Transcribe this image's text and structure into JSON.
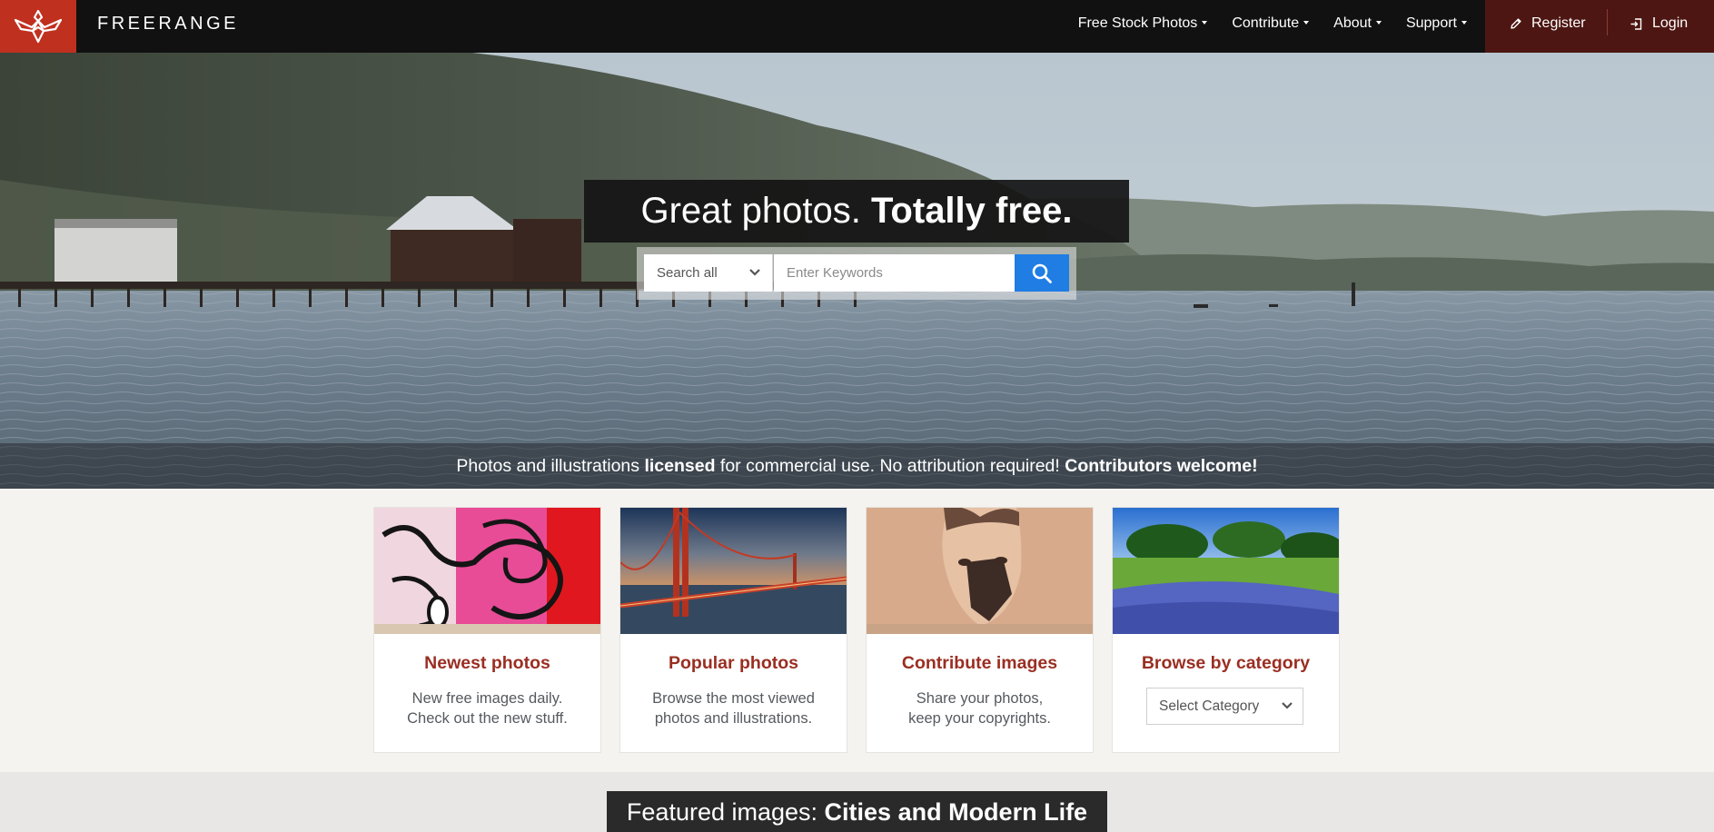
{
  "brand": {
    "name": "FREERANGE",
    "logo_color": "#c0301f",
    "logo_icon": "bird-logo-icon"
  },
  "nav": {
    "items": [
      {
        "label": "Free Stock Photos"
      },
      {
        "label": "Contribute"
      },
      {
        "label": "About"
      },
      {
        "label": "Support"
      }
    ],
    "register_label": "Register",
    "login_label": "Login",
    "register_icon": "pencil-icon",
    "login_icon": "login-icon"
  },
  "hero": {
    "title_light": "Great photos.",
    "title_bold": "Totally free.",
    "search": {
      "scope_value": "Search all",
      "placeholder": "Enter Keywords",
      "button_icon": "search-icon",
      "button_color": "#1f7de4"
    },
    "tagline": {
      "part1": "Photos and illustrations",
      "bold1": "licensed",
      "part2": "for commercial use. No attribution required!",
      "bold2": "Contributors welcome!"
    }
  },
  "cards": [
    {
      "title": "Newest photos",
      "desc_line1": "New free images daily.",
      "desc_line2": "Check out the new stuff.",
      "image": "graffiti"
    },
    {
      "title": "Popular photos",
      "desc_line1": "Browse the most viewed",
      "desc_line2": "photos and illustrations.",
      "image": "golden-gate-bridge"
    },
    {
      "title": "Contribute images",
      "desc_line1": "Share your photos,",
      "desc_line2": "keep your copyrights.",
      "image": "painted-face-portrait"
    },
    {
      "title": "Browse by category",
      "select_value": "Select Category",
      "image": "flower-meadow"
    }
  ],
  "featured": {
    "prefix": "Featured images:",
    "name": "Cities and Modern Life"
  },
  "colors": {
    "accent_red": "#9a2e22",
    "nav_bg": "#111111",
    "auth_bg": "#4d1612",
    "page_bg": "#f4f3ef"
  }
}
